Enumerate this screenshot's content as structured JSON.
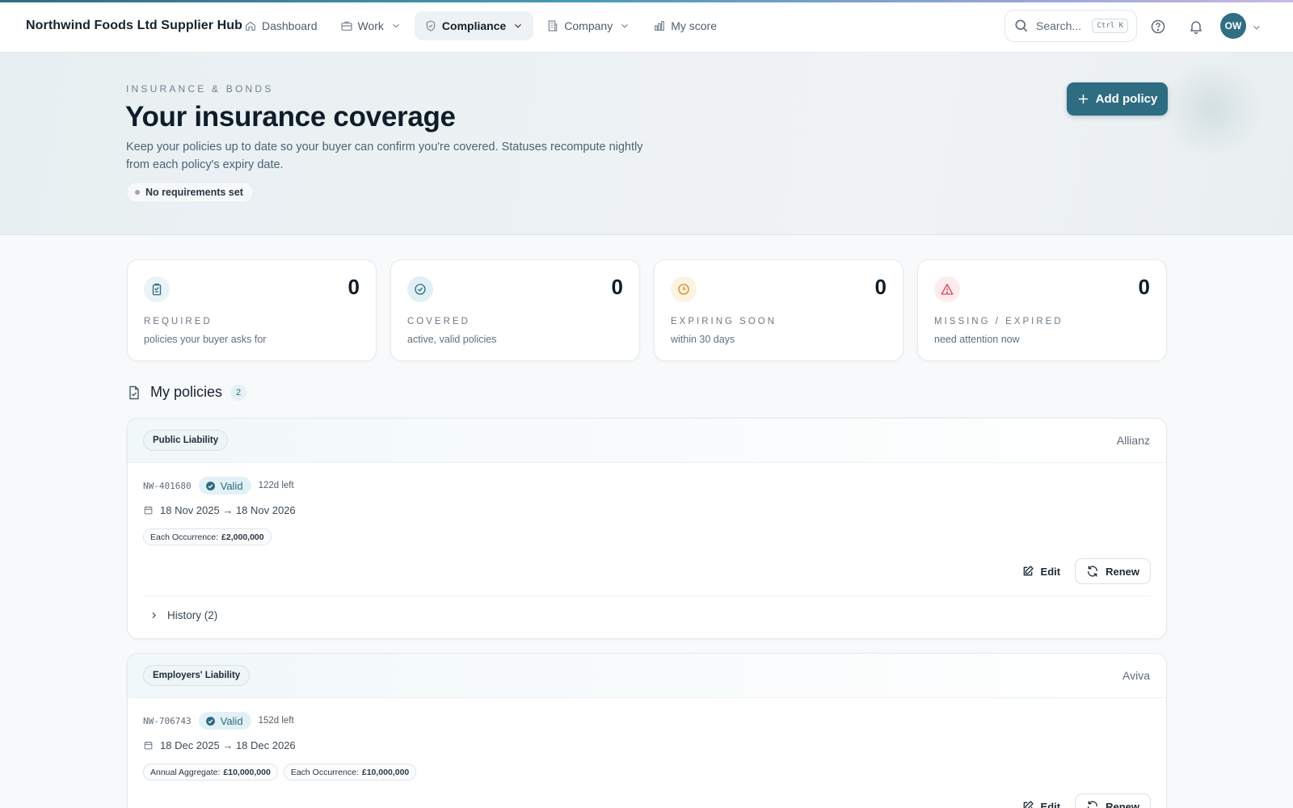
{
  "brand": "Northwind Foods Ltd Supplier Hub",
  "nav": [
    {
      "label": "Dashboard",
      "icon": "home-icon"
    },
    {
      "label": "Work",
      "icon": "briefcase-icon"
    },
    {
      "label": "Compliance",
      "icon": "shield-icon"
    },
    {
      "label": "Company",
      "icon": "building-icon"
    },
    {
      "label": "My score",
      "icon": "bar-chart-icon"
    }
  ],
  "search": {
    "placeholder": "Search...",
    "shortcut": "Ctrl K"
  },
  "user": {
    "initials": "OW"
  },
  "hero": {
    "eyebrow": "INSURANCE & BONDS",
    "title": "Your insurance coverage",
    "description": "Keep your policies up to date so your buyer can confirm you're covered. Statuses recompute nightly from each policy's expiry date.",
    "requirements_status": "No requirements set",
    "add_button": "Add policy"
  },
  "stats": [
    {
      "value": "0",
      "label": "REQUIRED",
      "sub": "policies your buyer asks for",
      "icon": "clipboard-icon",
      "color": "#2f6e83"
    },
    {
      "value": "0",
      "label": "COVERED",
      "sub": "active, valid policies",
      "icon": "check-circle-icon",
      "color": "#2f6e83"
    },
    {
      "value": "0",
      "label": "EXPIRING SOON",
      "sub": "within 30 days",
      "icon": "clock-icon",
      "color": "#d48a1a"
    },
    {
      "value": "0",
      "label": "MISSING / EXPIRED",
      "sub": "need attention now",
      "icon": "warning-icon",
      "color": "#d9485a"
    }
  ],
  "policies_section": {
    "title": "My policies",
    "count": "2"
  },
  "policies": [
    {
      "type": "Public Liability",
      "insurer": "Allianz",
      "number": "NW-401680",
      "status": "Valid",
      "days_left": "122d left",
      "dates": "18 Nov 2025 → 18 Nov 2026",
      "limits": [
        {
          "label": "Each Occurrence:",
          "value": "£2,000,000"
        }
      ],
      "edit": "Edit",
      "renew": "Renew",
      "history": "History (2)"
    },
    {
      "type": "Employers' Liability",
      "insurer": "Aviva",
      "number": "NW-706743",
      "status": "Valid",
      "days_left": "152d left",
      "dates": "18 Dec 2025 → 18 Dec 2026",
      "limits": [
        {
          "label": "Annual Aggregate:",
          "value": "£10,000,000"
        },
        {
          "label": "Each Occurrence:",
          "value": "£10,000,000"
        }
      ],
      "edit": "Edit",
      "renew": "Renew"
    }
  ]
}
